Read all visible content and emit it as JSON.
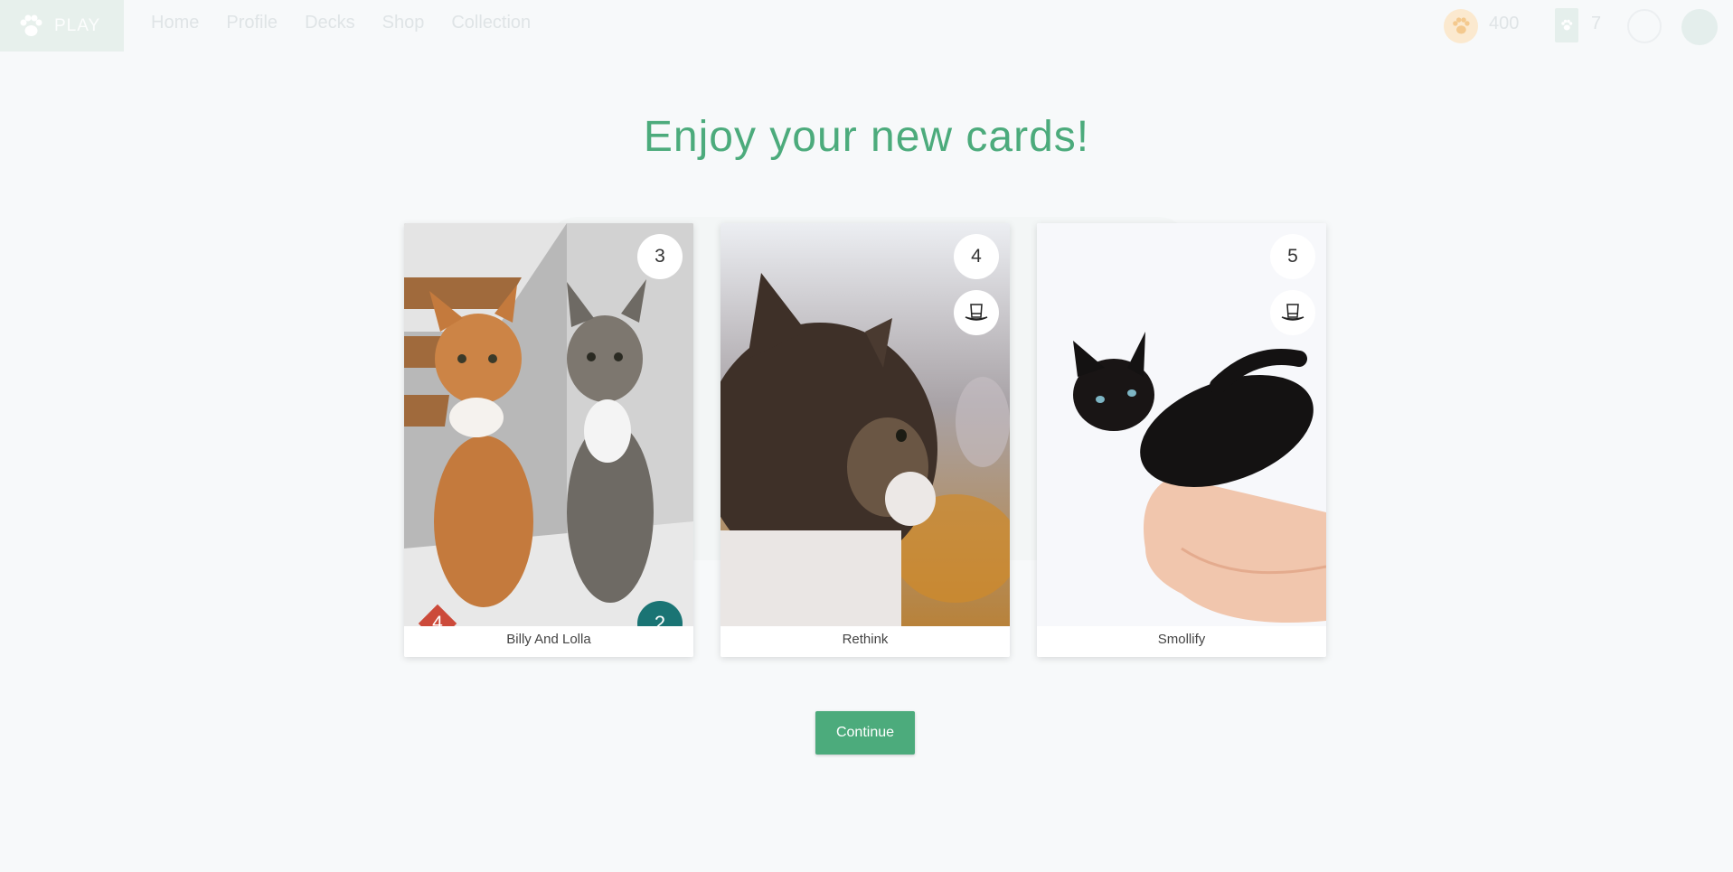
{
  "nav": {
    "play_label": "PLAY",
    "links": [
      "Home",
      "Profile",
      "Decks",
      "Shop",
      "Collection"
    ],
    "coins": "400",
    "decks": "7"
  },
  "headline": "Enjoy your new cards!",
  "cards": [
    {
      "name": "Billy And Lolla",
      "cost": "3",
      "attack": "4",
      "health": "2",
      "ability": ""
    },
    {
      "name": "Rethink",
      "cost": "4",
      "ability": "top-hat-icon"
    },
    {
      "name": "Smollify",
      "cost": "5",
      "ability": "top-hat-icon"
    }
  ],
  "continue_label": "Continue",
  "colors": {
    "accent": "#4cab7c",
    "attack": "#cc4a3a",
    "health": "#1a7474"
  }
}
